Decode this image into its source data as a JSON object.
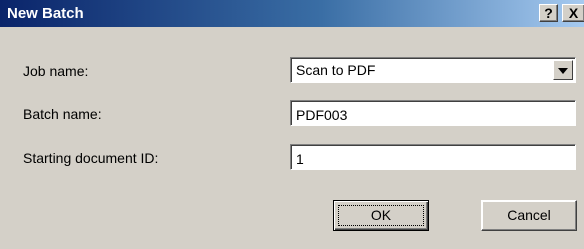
{
  "window": {
    "title": "New Batch",
    "help_label": "?",
    "close_label": "X"
  },
  "form": {
    "job_name": {
      "label": "Job name:",
      "value": "Scan to PDF"
    },
    "batch_name": {
      "label": "Batch name:",
      "value": "PDF003"
    },
    "starting_document_id": {
      "label": "Starting document ID:",
      "value": "1"
    }
  },
  "buttons": {
    "ok_label": "OK",
    "cancel_label": "Cancel"
  },
  "colors": {
    "titlebar_start": "#0a246a",
    "titlebar_end": "#a6caf0",
    "face": "#d4d0c8"
  }
}
